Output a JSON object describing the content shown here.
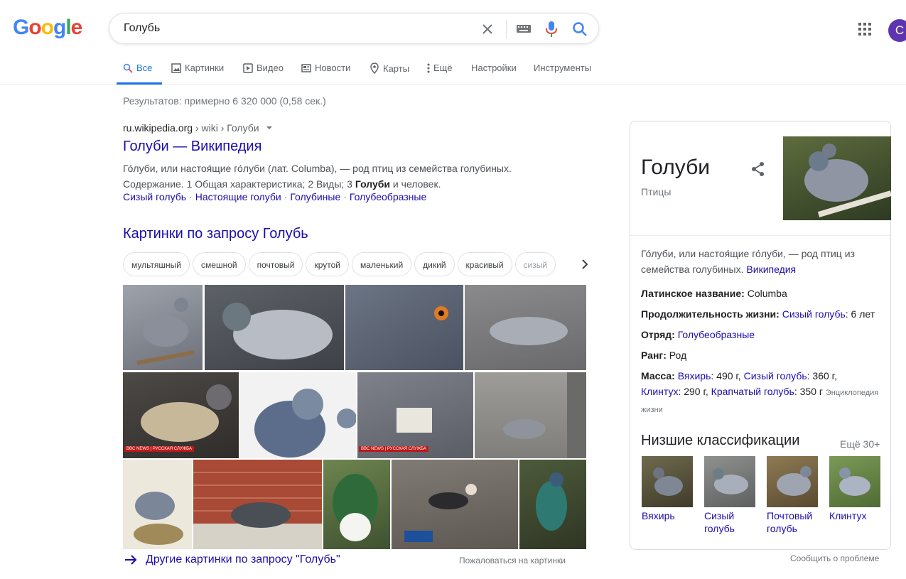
{
  "logo": {
    "text": "Google"
  },
  "search": {
    "query": "Голубь",
    "clear_icon": "close-icon",
    "keyboard_icon": "keyboard-icon",
    "mic_icon": "mic-icon",
    "search_icon": "search-icon"
  },
  "user": {
    "avatar_letter": "С"
  },
  "tabs": [
    {
      "label": "Все",
      "icon": "search-icon",
      "active": true
    },
    {
      "label": "Картинки",
      "icon": "image-icon"
    },
    {
      "label": "Видео",
      "icon": "video-icon"
    },
    {
      "label": "Новости",
      "icon": "news-icon"
    },
    {
      "label": "Карты",
      "icon": "map-pin-icon"
    },
    {
      "label": "Ещё",
      "icon": "more-vert-icon"
    },
    {
      "label": "Настройки"
    },
    {
      "label": "Инструменты"
    }
  ],
  "stats": "Результатов: примерно 6 320 000 (0,58 сек.)",
  "result": {
    "domain": "ru.wikipedia.org",
    "path": " › wiki › Голуби",
    "title": "Голуби — Википедия",
    "snippet_line1": "Го́луби, или настоя́щие го́луби (лат. Columba), — род птиц из семейства голубиных.",
    "snippet_line2_a": "Содержание. 1 Общая характеристика; 2 Виды; 3 ",
    "snippet_line2_bold": "Голуби",
    "snippet_line2_b": " и человек.",
    "sitelinks": [
      "Сизый голубь",
      "Настоящие голуби",
      "Голубиные",
      "Голубеобразные"
    ]
  },
  "images": {
    "title": "Картинки по запросу Голубь",
    "chips": [
      "мультяшный",
      "смешной",
      "почтовый",
      "крутой",
      "маленький",
      "дикий",
      "красивый",
      "сизый"
    ],
    "more_link": "Другие картинки по запросу \"Голубь\"",
    "report": "Пожаловаться на картинки",
    "bbc_badge": "BBC NEWS | РУССКАЯ СЛУЖБА"
  },
  "knowledge_panel": {
    "title": "Голуби",
    "subtitle": "Птицы",
    "description": "Го́луби, или настоя́щие го́луби, — род птиц из семейства голубиных.",
    "description_source": "Википедия",
    "latin_label": "Латинское название:",
    "latin_value": " Columba",
    "life_label": "Продолжительность жизни:",
    "life_link": "Сизый голубь",
    "life_value": ": 6 лет",
    "order_label": "Отряд:",
    "order_link": "Голубеобразные",
    "rank_label": "Ранг:",
    "rank_value": " Род",
    "mass_label": "Масса:",
    "mass_l1": "Вяхирь",
    "mass_v1": ": 490 г, ",
    "mass_l2": "Сизый голубь",
    "mass_v2": ": 360 г,",
    "mass_l3": "Клинтух",
    "mass_v3": ": 290 г, ",
    "mass_l4": "Крапчатый голубь",
    "mass_v4": ": 350 г ",
    "mass_source": "Энциклопедия жизни",
    "subclass_title": "Низшие классификации",
    "subclass_more": "Ещё 30+",
    "subclasses": [
      "Вяхирь",
      "Сизый голубь",
      "Почтовый голубь",
      "Клинтух"
    ],
    "report": "Сообщить о проблеме"
  },
  "colors": {
    "link": "#1a0dab",
    "accent": "#1a73e8",
    "avatar": "#5e35b1"
  }
}
